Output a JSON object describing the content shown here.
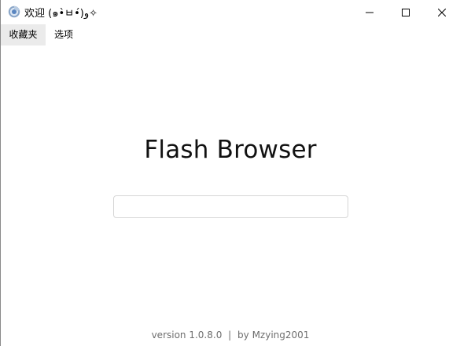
{
  "window": {
    "title": "欢迎 (๑•̀ㅂ•́)و✧",
    "icon": "browser-app-icon"
  },
  "menu": {
    "items": [
      {
        "label": "收藏夹"
      },
      {
        "label": "选项"
      }
    ]
  },
  "main": {
    "title": "Flash Browser",
    "search": {
      "value": "",
      "placeholder": ""
    }
  },
  "footer": {
    "version": "version 1.0.8.0",
    "separator": "|",
    "author": "by Mzying2001"
  },
  "colors": {
    "active_menu_bg": "#ebebeb",
    "footer_text": "#6e6e6e",
    "input_border": "#d6d6d6"
  }
}
